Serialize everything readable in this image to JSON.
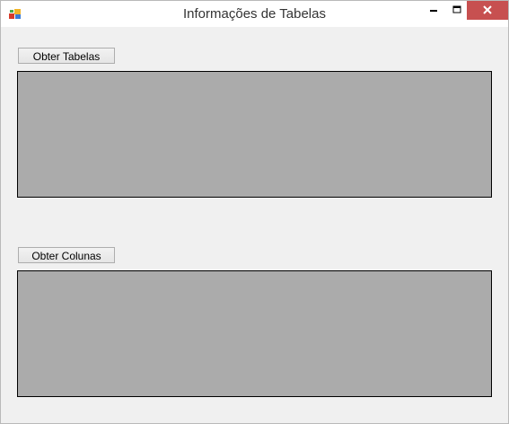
{
  "window": {
    "title": "Informações de Tabelas",
    "icon": "winforms-app-icon",
    "controls": {
      "minimize_icon": "minimize-icon",
      "maximize_icon": "maximize-icon",
      "close_icon": "close-icon",
      "close_color": "#c75050"
    }
  },
  "tables_section": {
    "button_label": "Obter Tabelas",
    "grid_background": "#ababab"
  },
  "columns_section": {
    "button_label": "Obter Colunas",
    "grid_background": "#ababab"
  }
}
